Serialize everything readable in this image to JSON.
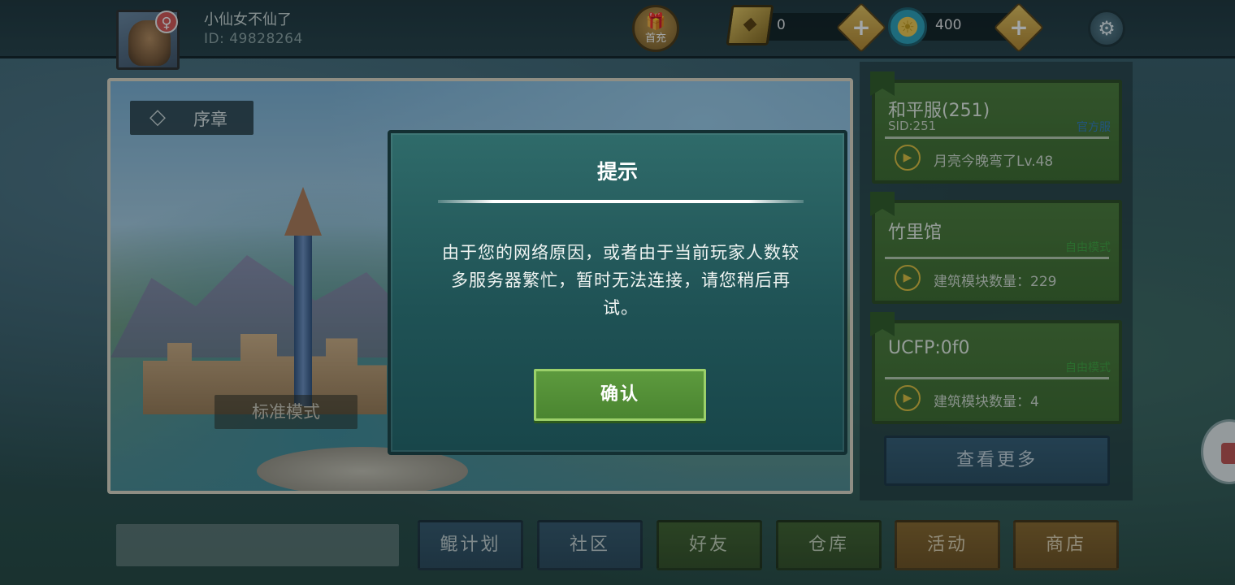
{
  "player": {
    "name": "小仙女不仙了",
    "id": "ID: 49828264",
    "gender_icon": "♀"
  },
  "topbar": {
    "gift_label": "首充",
    "gift_icon": "🎁",
    "diamonds": "0",
    "suns": "400",
    "diamond_icon": "◆",
    "sun_icon": "☀",
    "plus": "+",
    "settings_icon": "⚙"
  },
  "scene": {
    "chapter_icon": "◇",
    "chapter_label": "序章",
    "mode_label": "标准模式"
  },
  "servers": [
    {
      "name": "和平服(251)",
      "sid": "SID:251",
      "tag": "官方服",
      "play_icon": "▶",
      "info": "月亮今晚弯了Lv.48"
    },
    {
      "name": "竹里馆",
      "sid": "",
      "tag": "自由模式",
      "play_icon": "▶",
      "info": "建筑模块数量：229"
    },
    {
      "name": "UCFP:0f0",
      "sid": "",
      "tag": "自由模式",
      "play_icon": "▶",
      "info": "建筑模块数量：4"
    }
  ],
  "more_button": "查看更多",
  "nav": {
    "kun_plan": "鲲计划",
    "community": "社区",
    "friends": "好友",
    "warehouse": "仓库",
    "events": "活动",
    "shop": "商店"
  },
  "dialog": {
    "title": "提示",
    "message": "由于您的网络原因，或者由于当前玩家人数较多服务器繁忙，暂时无法连接，请您稍后再试。",
    "confirm": "确认"
  },
  "colors": {
    "dialog_bg": "#1f5255",
    "confirm_green": "#5d9a3e",
    "server_card_green": "#4b7a35",
    "nav_orange": "#8a6528",
    "nav_blue": "#34566a"
  }
}
